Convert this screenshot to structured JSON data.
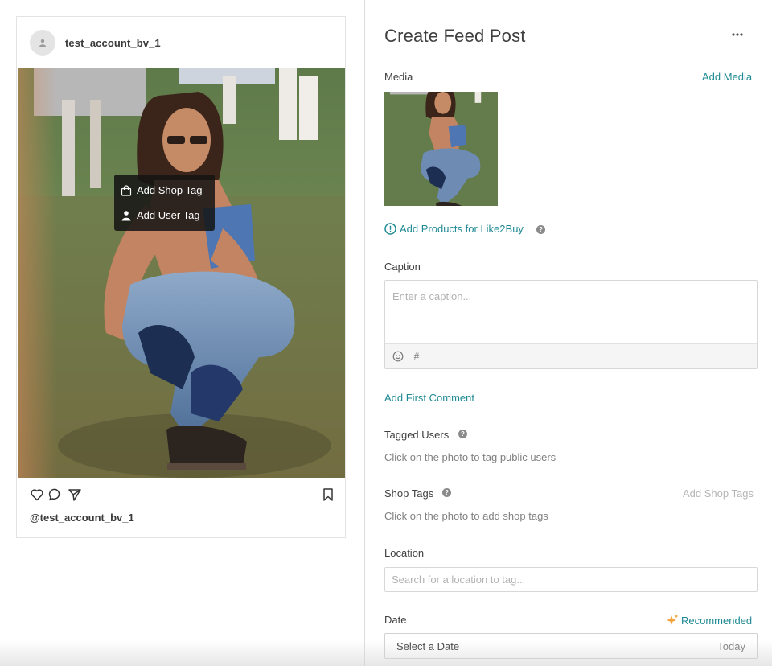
{
  "preview": {
    "username": "test_account_bv_1",
    "caption_username": "@test_account_bv_1",
    "tag_menu": {
      "shop_tag": "Add Shop Tag",
      "user_tag": "Add User Tag"
    },
    "actions": [
      "heart-icon",
      "comment-icon",
      "share-icon",
      "bookmark-icon"
    ]
  },
  "form": {
    "title": "Create Feed Post",
    "media": {
      "label": "Media",
      "add_link": "Add Media"
    },
    "like2buy": {
      "label": "Add Products for Like2Buy"
    },
    "caption": {
      "label": "Caption",
      "placeholder": "Enter a caption...",
      "value": "",
      "tools": [
        "emoji-icon",
        "hashtag-icon"
      ]
    },
    "first_comment": "Add First Comment",
    "tagged_users": {
      "label": "Tagged Users",
      "hint": "Click on the photo to tag public users"
    },
    "shop_tags": {
      "label": "Shop Tags",
      "hint": "Click on the photo to add shop tags",
      "action": "Add Shop Tags"
    },
    "location": {
      "label": "Location",
      "placeholder": "Search for a location to tag...",
      "value": ""
    },
    "date": {
      "label": "Date",
      "recommended": "Recommended",
      "select_label": "Select a Date",
      "select_value": "Today"
    }
  },
  "colors": {
    "accent": "#1f8a93",
    "muted": "#b6b6b6",
    "border": "#d8d8d8",
    "recommended_star": "#f2a33a"
  }
}
